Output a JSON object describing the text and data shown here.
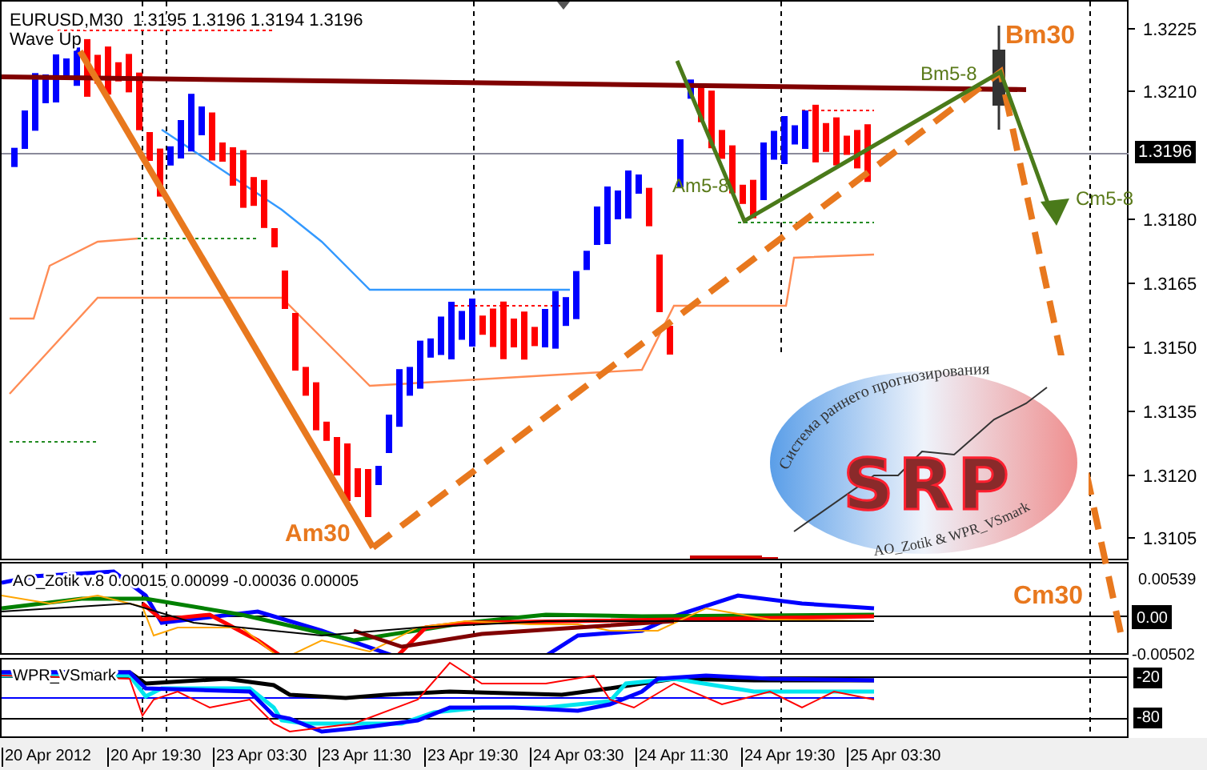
{
  "header": {
    "symbol": "EURUSD,M30",
    "ohlc": "1.3195 1.3196 1.3194 1.3196",
    "indicator": "Wave Up"
  },
  "price_axis": {
    "ticks": [
      "1.3225",
      "1.3210",
      "1.3180",
      "1.3165",
      "1.3150",
      "1.3135",
      "1.3120",
      "1.3105"
    ],
    "current_price": "1.3196"
  },
  "wave_labels": [
    {
      "text": "Am30",
      "color": "#e8781e"
    },
    {
      "text": "Bm30",
      "color": "#e8781e"
    },
    {
      "text": "Cm30",
      "color": "#e8781e"
    },
    {
      "text": "Am5-8",
      "color": "#5a7a1a"
    },
    {
      "text": "Bm5-8",
      "color": "#5a7a1a"
    },
    {
      "text": "Cm5-8",
      "color": "#5a7a1a"
    }
  ],
  "logo": {
    "arc_text": "Система раннего прогнозирования",
    "title": "SRP",
    "credit": "AO_Zotik & WPR_VSmark"
  },
  "ao_panel": {
    "title": "AO_Zotik v.8 0.00015 0.00099 -0.00036 0.00005",
    "top_tick": "0.00539",
    "zero_label": "0.00",
    "bottom_tick": "-0.00502"
  },
  "wpr_panel": {
    "title": "WPR_VSmark",
    "levels": [
      "-20",
      "-80"
    ]
  },
  "time_axis": [
    "20 Apr 2012",
    "20 Apr 19:30",
    "23 Apr 03:30",
    "23 Apr 11:30",
    "23 Apr 19:30",
    "24 Apr 03:30",
    "24 Apr 11:30",
    "24 Apr 19:30",
    "25 Apr 03:30"
  ]
}
